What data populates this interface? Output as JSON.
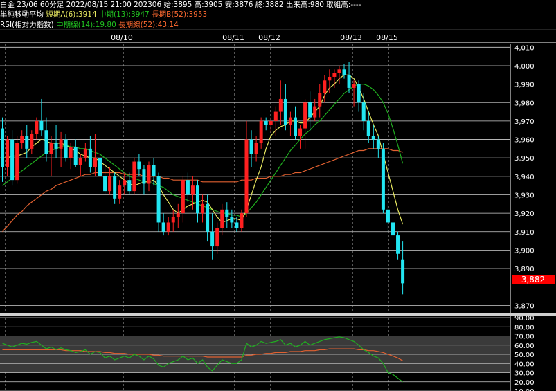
{
  "header": {
    "line1": "白金 23/06 60分足 2022/08/15 21:00 202306 始:3895 高:3905 安:3876 終:3882 出来高:980 取組高:----",
    "sma_title": "単純移動平均",
    "sma_short": "短期A(6):3914",
    "sma_mid": "中期(13):3947",
    "sma_long": "長期B(52):3953",
    "rsi_title": "RSI(相対力指数)",
    "rsi_mid": "中期線(14):19.80",
    "rsi_long": "長期線(52):43.14"
  },
  "colors": {
    "up": "#ff2020",
    "down": "#22e6f2",
    "sma_short": "#e8e860",
    "sma_mid": "#20b020",
    "sma_long": "#e06030",
    "last_price_box": "#ff0000"
  },
  "last_price": "3,882",
  "chart_data": [
    {
      "type": "candlestick",
      "x_dates": [
        "08/10",
        "08/11",
        "08/12",
        "08/13",
        "08/15"
      ],
      "y_ticks": [
        "4,010",
        "4,000",
        "3,990",
        "3,980",
        "3,970",
        "3,960",
        "3,950",
        "3,940",
        "3,930",
        "3,920",
        "3,910",
        "3,900",
        "3,890",
        "3,870"
      ],
      "ylim": [
        3866,
        4012
      ],
      "grid": true,
      "candles": [
        [
          3966,
          3972,
          3937,
          3945
        ],
        [
          3945,
          3962,
          3940,
          3960
        ],
        [
          3960,
          3965,
          3935,
          3938
        ],
        [
          3938,
          3962,
          3936,
          3958
        ],
        [
          3958,
          3965,
          3955,
          3962
        ],
        [
          3962,
          3968,
          3950,
          3955
        ],
        [
          3955,
          3965,
          3952,
          3963
        ],
        [
          3963,
          3972,
          3960,
          3970
        ],
        [
          3970,
          3982,
          3962,
          3965
        ],
        [
          3965,
          3972,
          3948,
          3952
        ],
        [
          3952,
          3962,
          3940,
          3958
        ],
        [
          3958,
          3968,
          3950,
          3955
        ],
        [
          3955,
          3964,
          3945,
          3960
        ],
        [
          3960,
          3963,
          3948,
          3950
        ],
        [
          3950,
          3958,
          3944,
          3956
        ],
        [
          3956,
          3960,
          3945,
          3946
        ],
        [
          3946,
          3952,
          3940,
          3950
        ],
        [
          3950,
          3958,
          3948,
          3955
        ],
        [
          3955,
          3962,
          3942,
          3945
        ],
        [
          3945,
          3963,
          3940,
          3950
        ],
        [
          3950,
          3968,
          3945,
          3940
        ],
        [
          3940,
          3950,
          3930,
          3932
        ],
        [
          3932,
          3945,
          3930,
          3940
        ],
        [
          3940,
          3942,
          3925,
          3928
        ],
        [
          3928,
          3938,
          3925,
          3935
        ],
        [
          3935,
          3942,
          3930,
          3938
        ],
        [
          3938,
          3942,
          3930,
          3932
        ],
        [
          3932,
          3950,
          3930,
          3948
        ],
        [
          3948,
          3952,
          3940,
          3944
        ],
        [
          3944,
          3946,
          3930,
          3936
        ],
        [
          3936,
          3948,
          3932,
          3946
        ],
        [
          3946,
          3950,
          3935,
          3940
        ],
        [
          3940,
          3942,
          3910,
          3915
        ],
        [
          3915,
          3920,
          3908,
          3910
        ],
        [
          3910,
          3918,
          3908,
          3915
        ],
        [
          3915,
          3922,
          3910,
          3918
        ],
        [
          3918,
          3925,
          3912,
          3920
        ],
        [
          3920,
          3940,
          3915,
          3938
        ],
        [
          3938,
          3942,
          3926,
          3930
        ],
        [
          3930,
          3940,
          3922,
          3935
        ],
        [
          3935,
          3938,
          3915,
          3920
        ],
        [
          3920,
          3930,
          3915,
          3925
        ],
        [
          3925,
          3930,
          3905,
          3910
        ],
        [
          3910,
          3920,
          3895,
          3902
        ],
        [
          3902,
          3915,
          3898,
          3912
        ],
        [
          3912,
          3925,
          3908,
          3922
        ],
        [
          3922,
          3926,
          3912,
          3918
        ],
        [
          3918,
          3922,
          3912,
          3915
        ],
        [
          3915,
          3918,
          3910,
          3912
        ],
        [
          3912,
          3922,
          3910,
          3920
        ],
        [
          3920,
          3970,
          3918,
          3960
        ],
        [
          3960,
          3965,
          3945,
          3952
        ],
        [
          3952,
          3962,
          3948,
          3958
        ],
        [
          3958,
          3972,
          3955,
          3970
        ],
        [
          3970,
          3972,
          3965,
          3968
        ],
        [
          3968,
          3972,
          3964,
          3970
        ],
        [
          3970,
          3978,
          3962,
          3975
        ],
        [
          3975,
          3992,
          3968,
          3982
        ],
        [
          3982,
          3990,
          3965,
          3968
        ],
        [
          3968,
          3975,
          3962,
          3972
        ],
        [
          3972,
          3978,
          3960,
          3962
        ],
        [
          3962,
          3968,
          3955,
          3966
        ],
        [
          3966,
          3982,
          3955,
          3980
        ],
        [
          3980,
          3986,
          3965,
          3972
        ],
        [
          3972,
          3982,
          3970,
          3978
        ],
        [
          3978,
          3990,
          3972,
          3985
        ],
        [
          3985,
          3995,
          3980,
          3992
        ],
        [
          3992,
          3998,
          3985,
          3994
        ],
        [
          3994,
          3998,
          3988,
          3996
        ],
        [
          3996,
          4000,
          3990,
          3998
        ],
        [
          3998,
          4001,
          3993,
          3995
        ],
        [
          3995,
          4002,
          3985,
          3988
        ],
        [
          3988,
          3992,
          3978,
          3990
        ],
        [
          3990,
          3992,
          3975,
          3980
        ],
        [
          3980,
          3985,
          3965,
          3970
        ],
        [
          3970,
          3975,
          3958,
          3962
        ],
        [
          3962,
          3968,
          3955,
          3960
        ],
        [
          3960,
          3962,
          3950,
          3955
        ],
        [
          3955,
          3958,
          3920,
          3922
        ],
        [
          3922,
          3925,
          3910,
          3915
        ],
        [
          3915,
          3918,
          3905,
          3908
        ],
        [
          3908,
          3910,
          3895,
          3898
        ],
        [
          3895,
          3905,
          3876,
          3882
        ]
      ],
      "sma_short": [
        3950,
        3950,
        3951,
        3951,
        3952,
        3953,
        3956,
        3958,
        3960,
        3959,
        3958,
        3958,
        3958,
        3957,
        3955,
        3954,
        3952,
        3951,
        3950,
        3950,
        3948,
        3946,
        3944,
        3942,
        3940,
        3938,
        3936,
        3935,
        3936,
        3937,
        3937,
        3938,
        3935,
        3930,
        3926,
        3922,
        3920,
        3922,
        3924,
        3925,
        3926,
        3927,
        3926,
        3922,
        3918,
        3915,
        3916,
        3917,
        3917,
        3916,
        3922,
        3930,
        3938,
        3945,
        3955,
        3962,
        3965,
        3967,
        3968,
        3970,
        3970,
        3969,
        3969,
        3972,
        3975,
        3978,
        3984,
        3988,
        3990,
        3993,
        3995,
        3995,
        3993,
        3988,
        3982,
        3975,
        3968,
        3962,
        3952,
        3942,
        3932,
        3922,
        3914
      ],
      "sma_mid": [
        3935,
        3937,
        3939,
        3941,
        3943,
        3945,
        3947,
        3949,
        3951,
        3953,
        3954,
        3955,
        3956,
        3957,
        3956,
        3956,
        3955,
        3955,
        3954,
        3953,
        3952,
        3950,
        3948,
        3946,
        3944,
        3942,
        3940,
        3939,
        3938,
        3937,
        3937,
        3936,
        3935,
        3934,
        3932,
        3930,
        3929,
        3928,
        3927,
        3926,
        3925,
        3924,
        3923,
        3922,
        3921,
        3920,
        3920,
        3919,
        3919,
        3918,
        3920,
        3923,
        3926,
        3930,
        3934,
        3938,
        3942,
        3946,
        3950,
        3954,
        3957,
        3960,
        3963,
        3965,
        3968,
        3970,
        3973,
        3976,
        3979,
        3982,
        3985,
        3987,
        3989,
        3990,
        3990,
        3989,
        3987,
        3984,
        3980,
        3974,
        3966,
        3957,
        3947
      ],
      "sma_long": [
        3910,
        3913,
        3916,
        3919,
        3921,
        3924,
        3926,
        3928,
        3930,
        3932,
        3933,
        3935,
        3936,
        3937,
        3938,
        3939,
        3940,
        3941,
        3941,
        3942,
        3942,
        3942,
        3942,
        3942,
        3942,
        3941,
        3941,
        3941,
        3941,
        3940,
        3940,
        3940,
        3940,
        3939,
        3939,
        3938,
        3938,
        3938,
        3938,
        3938,
        3938,
        3937,
        3937,
        3937,
        3937,
        3937,
        3937,
        3937,
        3937,
        3938,
        3938,
        3938,
        3939,
        3939,
        3939,
        3940,
        3940,
        3940,
        3941,
        3941,
        3942,
        3942,
        3943,
        3944,
        3945,
        3946,
        3947,
        3948,
        3949,
        3950,
        3951,
        3952,
        3953,
        3954,
        3954,
        3955,
        3955,
        3955,
        3955,
        3955,
        3954,
        3954,
        3953
      ]
    },
    {
      "type": "line",
      "y_ticks": [
        "90.00",
        "80.00",
        "70.00",
        "60.00",
        "50.00",
        "40.00",
        "30.00",
        "20.00",
        "10.00"
      ],
      "ylim": [
        10,
        90
      ],
      "bands": [
        [
          30,
          70
        ]
      ],
      "series": [
        {
          "values": [
            62,
            60,
            58,
            60,
            62,
            61,
            63,
            64,
            60,
            56,
            58,
            55,
            57,
            55,
            54,
            52,
            53,
            55,
            50,
            53,
            52,
            46,
            48,
            44,
            46,
            48,
            46,
            50,
            48,
            44,
            48,
            45,
            38,
            36,
            40,
            42,
            44,
            48,
            44,
            46,
            40,
            44,
            36,
            32,
            38,
            44,
            42,
            40,
            40,
            44,
            62,
            58,
            60,
            64,
            62,
            63,
            64,
            66,
            60,
            62,
            58,
            60,
            64,
            60,
            62,
            64,
            66,
            67,
            68,
            69,
            68,
            66,
            64,
            60,
            55,
            52,
            48,
            46,
            40,
            30,
            28,
            24,
            20
          ]
        },
        {
          "values": [
            55,
            55,
            55,
            55,
            55,
            55,
            55,
            55,
            55,
            55,
            55,
            55,
            55,
            54,
            54,
            54,
            54,
            53,
            53,
            53,
            53,
            52,
            52,
            51,
            51,
            51,
            50,
            50,
            50,
            50,
            50,
            49,
            49,
            48,
            48,
            48,
            48,
            48,
            48,
            48,
            48,
            48,
            47,
            47,
            47,
            47,
            47,
            47,
            47,
            47,
            49,
            49,
            50,
            50,
            51,
            51,
            52,
            52,
            52,
            53,
            53,
            53,
            54,
            54,
            54,
            55,
            55,
            56,
            56,
            56,
            56,
            56,
            56,
            55,
            55,
            54,
            54,
            53,
            52,
            50,
            48,
            46,
            43
          ]
        }
      ]
    }
  ]
}
